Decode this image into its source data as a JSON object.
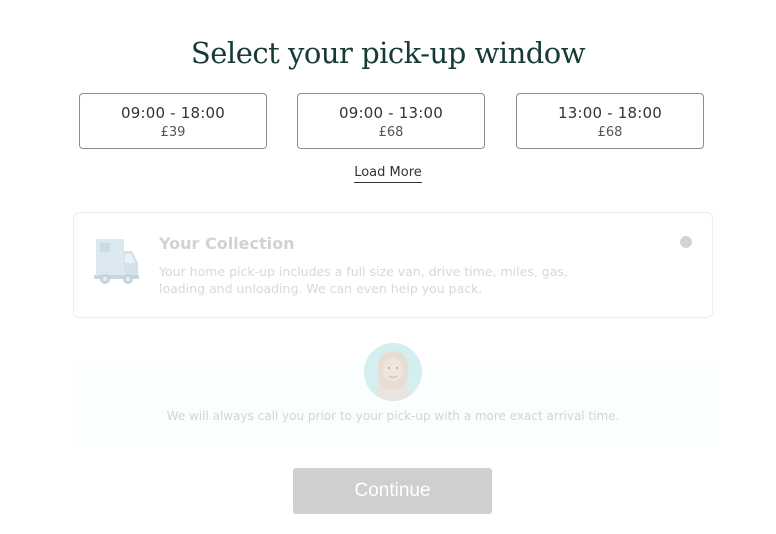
{
  "page": {
    "title": "Select your pick-up window"
  },
  "slots": [
    {
      "time": "09:00 - 18:00",
      "price": "£39"
    },
    {
      "time": "09:00 - 13:00",
      "price": "£68"
    },
    {
      "time": "13:00 - 18:00",
      "price": "£68"
    }
  ],
  "load_more_label": "Load More",
  "collection": {
    "title": "Your Collection",
    "description": "Your home pick-up includes a full size van, drive time, miles, gas, loading and unloading. We can even help you pack.",
    "icon": "van-icon"
  },
  "call_notice": {
    "text": "We will always call you prior to your pick-up with a more exact arrival time.",
    "icon": "agent-avatar"
  },
  "continue_label": "Continue",
  "colors": {
    "title": "#173a35",
    "continue_bg": "#cfcfcf",
    "slot_border": "#8c8c8c"
  }
}
